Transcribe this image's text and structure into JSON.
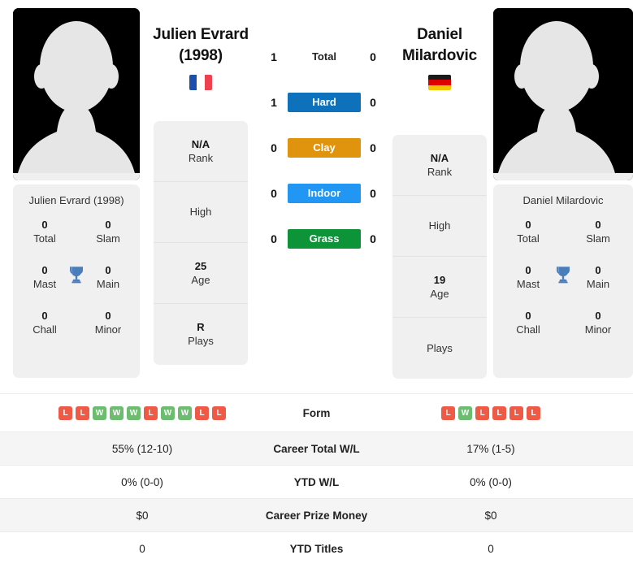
{
  "players": {
    "left": {
      "name_line1": "Julien Evrard",
      "name_line2": "(1998)",
      "full_name": "Julien Evrard (1998)",
      "flag": "fr-flag-icon",
      "avatar": "player-silhouette-avatar",
      "info": [
        {
          "value": "N/A",
          "label": "Rank"
        },
        {
          "value": "",
          "label": "High"
        },
        {
          "value": "25",
          "label": "Age"
        },
        {
          "value": "R",
          "label": "Plays"
        }
      ],
      "titles": [
        {
          "value": "0",
          "label": "Total"
        },
        {
          "value": "0",
          "label": "Slam"
        },
        {
          "value": "0",
          "label": "Mast"
        },
        {
          "value": "0",
          "label": "Main"
        },
        {
          "value": "0",
          "label": "Chall"
        },
        {
          "value": "0",
          "label": "Minor"
        }
      ],
      "form": [
        "L",
        "L",
        "W",
        "W",
        "W",
        "L",
        "W",
        "W",
        "L",
        "L"
      ],
      "career_total_wl": "55% (12-10)",
      "ytd_wl": "0% (0-0)",
      "career_prize_money": "$0",
      "ytd_titles": "0"
    },
    "right": {
      "name_line1": "Daniel",
      "name_line2": "Milardovic",
      "full_name": "Daniel Milardovic",
      "flag": "de-flag-icon",
      "avatar": "player-silhouette-avatar",
      "info": [
        {
          "value": "N/A",
          "label": "Rank"
        },
        {
          "value": "",
          "label": "High"
        },
        {
          "value": "19",
          "label": "Age"
        },
        {
          "value": "",
          "label": "Plays"
        }
      ],
      "titles": [
        {
          "value": "0",
          "label": "Total"
        },
        {
          "value": "0",
          "label": "Slam"
        },
        {
          "value": "0",
          "label": "Mast"
        },
        {
          "value": "0",
          "label": "Main"
        },
        {
          "value": "0",
          "label": "Chall"
        },
        {
          "value": "0",
          "label": "Minor"
        }
      ],
      "form": [
        "L",
        "W",
        "L",
        "L",
        "L",
        "L"
      ],
      "career_total_wl": "17% (1-5)",
      "ytd_wl": "0% (0-0)",
      "career_prize_money": "$0",
      "ytd_titles": "0"
    }
  },
  "h2h": [
    {
      "label": "Total",
      "left": "1",
      "right": "0",
      "color": "",
      "style": "plain"
    },
    {
      "label": "Hard",
      "left": "1",
      "right": "0",
      "color": "#0d71bb",
      "style": "bar"
    },
    {
      "label": "Clay",
      "left": "0",
      "right": "0",
      "color": "#e0940e",
      "style": "bar"
    },
    {
      "label": "Indoor",
      "left": "0",
      "right": "0",
      "color": "#2196f3",
      "style": "bar"
    },
    {
      "label": "Grass",
      "left": "0",
      "right": "0",
      "color": "#0d9439",
      "style": "bar"
    }
  ],
  "table_rows": [
    {
      "label": "Form",
      "type": "form",
      "left_key": "form",
      "right_key": "form"
    },
    {
      "label": "Career Total W/L",
      "type": "text",
      "left_key": "career_total_wl",
      "right_key": "career_total_wl"
    },
    {
      "label": "YTD W/L",
      "type": "text",
      "left_key": "ytd_wl",
      "right_key": "ytd_wl"
    },
    {
      "label": "Career Prize Money",
      "type": "text",
      "left_key": "career_prize_money",
      "right_key": "career_prize_money"
    },
    {
      "label": "YTD Titles",
      "type": "text",
      "left_key": "ytd_titles",
      "right_key": "ytd_titles"
    }
  ],
  "colors": {
    "trophy": "#4a7ebb",
    "win_badge": "#6cbd6f",
    "loss_badge": "#ef5a46",
    "card_bg": "#f0f0f0"
  }
}
